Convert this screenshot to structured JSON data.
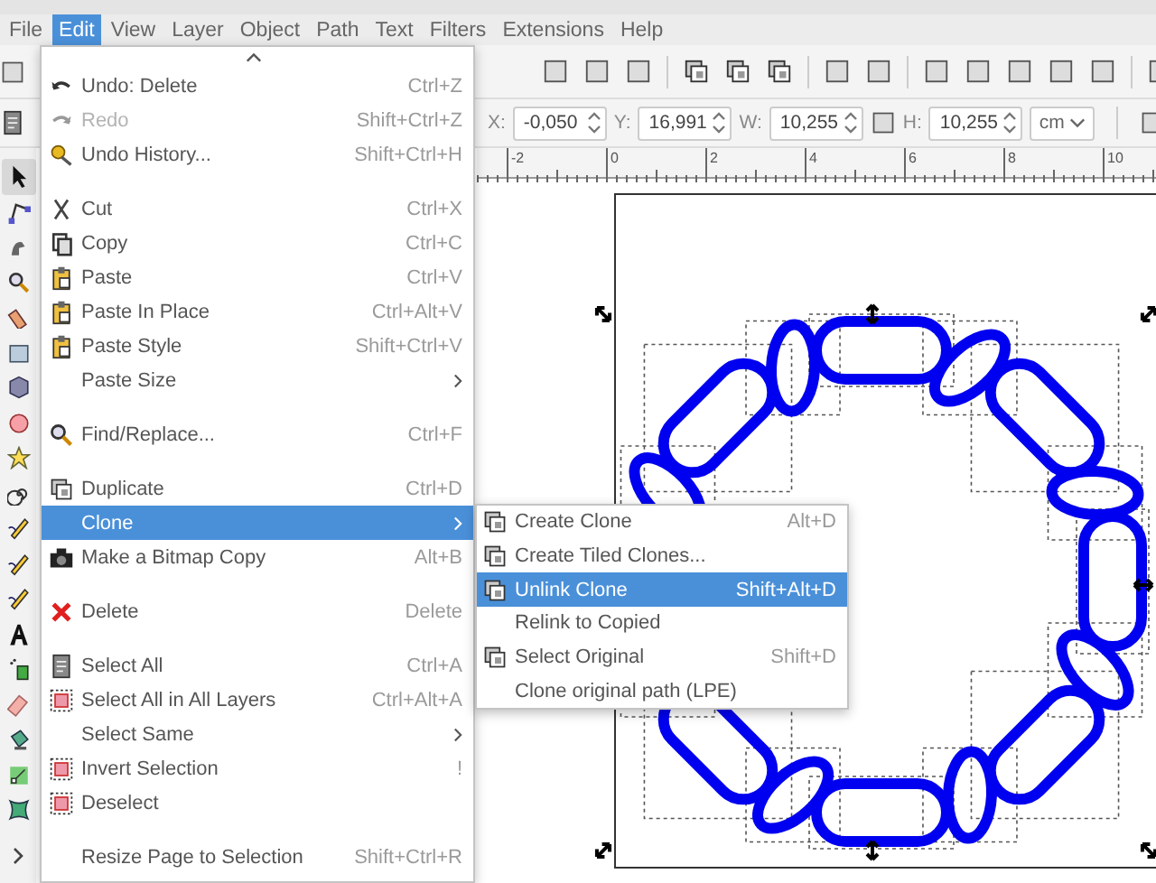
{
  "menubar": [
    {
      "label": "File",
      "selected": false
    },
    {
      "label": "Edit",
      "selected": true
    },
    {
      "label": "View",
      "selected": false
    },
    {
      "label": "Layer",
      "selected": false
    },
    {
      "label": "Object",
      "selected": false
    },
    {
      "label": "Path",
      "selected": false
    },
    {
      "label": "Text",
      "selected": false
    },
    {
      "label": "Filters",
      "selected": false
    },
    {
      "label": "Extensions",
      "selected": false
    },
    {
      "label": "Help",
      "selected": false
    }
  ],
  "tools": [
    {
      "selected": true
    },
    {
      "selected": false
    },
    {
      "selected": false
    },
    {
      "selected": false
    },
    {
      "selected": false
    },
    {
      "selected": false
    },
    {
      "selected": false
    },
    {
      "selected": false
    },
    {
      "selected": false
    },
    {
      "selected": false
    },
    {
      "selected": false
    },
    {
      "selected": false
    },
    {
      "selected": false
    },
    {
      "selected": false
    },
    {
      "selected": false
    },
    {
      "selected": false
    },
    {
      "selected": false
    },
    {
      "selected": false
    },
    {
      "selected": false
    }
  ],
  "fields": [
    {
      "label": "X:",
      "value": "-0,050"
    },
    {
      "label": "Y:",
      "value": "16,991"
    },
    {
      "label": "W:",
      "value": "10,255"
    },
    {
      "label": "H:",
      "value": "10,255"
    }
  ],
  "unit": "cm",
  "ruler_labels": [
    "-2",
    "0",
    "2",
    "4",
    "6",
    "8",
    "10"
  ],
  "edit_menu": {
    "items": [
      {
        "kind": "item",
        "label": "Undo: Delete",
        "shortcut": "Ctrl+Z",
        "disabled": false,
        "submenu": false,
        "selected": false
      },
      {
        "kind": "item",
        "label": "Redo",
        "shortcut": "Shift+Ctrl+Z",
        "disabled": true,
        "submenu": false,
        "selected": false
      },
      {
        "kind": "item",
        "label": "Undo History...",
        "shortcut": "Shift+Ctrl+H",
        "disabled": false,
        "submenu": false,
        "selected": false
      },
      {
        "kind": "separator"
      },
      {
        "kind": "item",
        "label": "Cut",
        "shortcut": "Ctrl+X",
        "disabled": false,
        "submenu": false,
        "selected": false
      },
      {
        "kind": "item",
        "label": "Copy",
        "shortcut": "Ctrl+C",
        "disabled": false,
        "submenu": false,
        "selected": false
      },
      {
        "kind": "item",
        "label": "Paste",
        "shortcut": "Ctrl+V",
        "disabled": false,
        "submenu": false,
        "selected": false
      },
      {
        "kind": "item",
        "label": "Paste In Place",
        "shortcut": "Ctrl+Alt+V",
        "disabled": false,
        "submenu": false,
        "selected": false
      },
      {
        "kind": "item",
        "label": "Paste Style",
        "shortcut": "Shift+Ctrl+V",
        "disabled": false,
        "submenu": false,
        "selected": false
      },
      {
        "kind": "item",
        "label": "Paste Size",
        "disabled": false,
        "submenu": true,
        "selected": false
      },
      {
        "kind": "separator"
      },
      {
        "kind": "item",
        "label": "Find/Replace...",
        "shortcut": "Ctrl+F",
        "disabled": false,
        "submenu": false,
        "selected": false
      },
      {
        "kind": "separator"
      },
      {
        "kind": "item",
        "label": "Duplicate",
        "shortcut": "Ctrl+D",
        "disabled": false,
        "submenu": false,
        "selected": false
      },
      {
        "kind": "item",
        "label": "Clone",
        "disabled": false,
        "submenu": true,
        "selected": true
      },
      {
        "kind": "item",
        "label": "Make a Bitmap Copy",
        "shortcut": "Alt+B",
        "disabled": false,
        "submenu": false,
        "selected": false
      },
      {
        "kind": "separator"
      },
      {
        "kind": "item",
        "label": "Delete",
        "shortcut": "Delete",
        "disabled": false,
        "submenu": false,
        "selected": false
      },
      {
        "kind": "separator"
      },
      {
        "kind": "item",
        "label": "Select All",
        "shortcut": "Ctrl+A",
        "disabled": false,
        "submenu": false,
        "selected": false
      },
      {
        "kind": "item",
        "label": "Select All in All Layers",
        "shortcut": "Ctrl+Alt+A",
        "disabled": false,
        "submenu": false,
        "selected": false
      },
      {
        "kind": "item",
        "label": "Select Same",
        "disabled": false,
        "submenu": true,
        "selected": false
      },
      {
        "kind": "item",
        "label": "Invert Selection",
        "shortcut": "!",
        "disabled": false,
        "submenu": false,
        "selected": false
      },
      {
        "kind": "item",
        "label": "Deselect",
        "disabled": false,
        "submenu": false,
        "selected": false
      },
      {
        "kind": "separator"
      },
      {
        "kind": "item",
        "label": "Resize Page to Selection",
        "shortcut": "Shift+Ctrl+R",
        "disabled": false,
        "submenu": false,
        "selected": false
      }
    ]
  },
  "clone_submenu": {
    "items": [
      {
        "kind": "item",
        "label": "Create Clone",
        "shortcut": "Alt+D",
        "disabled": false,
        "submenu": false,
        "selected": false
      },
      {
        "kind": "item",
        "label": "Create Tiled Clones...",
        "disabled": false,
        "submenu": false,
        "selected": false
      },
      {
        "kind": "item",
        "label": "Unlink Clone",
        "shortcut": "Shift+Alt+D",
        "disabled": false,
        "submenu": false,
        "selected": true
      },
      {
        "kind": "item",
        "label": "Relink to Copied",
        "disabled": false,
        "submenu": false,
        "selected": false
      },
      {
        "kind": "item",
        "label": "Select Original",
        "shortcut": "Shift+D",
        "disabled": false,
        "submenu": false,
        "selected": false
      },
      {
        "kind": "item",
        "label": "Clone original path (LPE)",
        "disabled": false,
        "submenu": false,
        "selected": false
      }
    ]
  }
}
